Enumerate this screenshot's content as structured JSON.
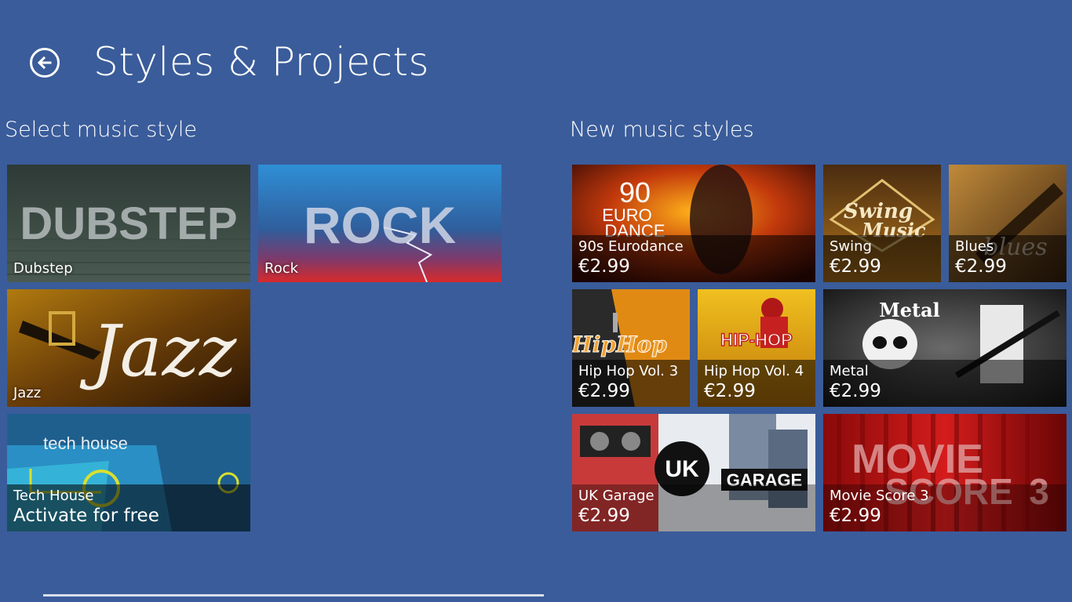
{
  "header": {
    "title": "Styles & Projects",
    "back_icon": "arrow-left-icon"
  },
  "colors": {
    "background": "#3a5c9a"
  },
  "left_section": {
    "title": "Select music style",
    "tiles": [
      {
        "id": "dubstep",
        "label": "Dubstep",
        "art_text": "DUBSTEP"
      },
      {
        "id": "rock",
        "label": "Rock",
        "art_text": "ROCK"
      },
      {
        "id": "jazz",
        "label": "Jazz",
        "art_text": "Jazz"
      },
      {
        "id": "techhouse",
        "label": "Tech House",
        "sub": "Activate for free",
        "art_text": "tech house"
      }
    ]
  },
  "right_section": {
    "title": "New music styles",
    "tiles": [
      {
        "id": "eurodance",
        "label": "90s Eurodance",
        "price": "€2.99",
        "art_text_1": "90",
        "art_text_2": "EURO",
        "art_text_3": "DANCE"
      },
      {
        "id": "swing",
        "label": "Swing",
        "price": "€2.99",
        "art_text_1": "Swing",
        "art_text_2": "Music"
      },
      {
        "id": "blues",
        "label": "Blues",
        "price": "€2.99",
        "art_text": "blues"
      },
      {
        "id": "hiphop3",
        "label": "Hip Hop Vol. 3",
        "price": "€2.99",
        "art_text": "HipHop"
      },
      {
        "id": "hiphop4",
        "label": "Hip Hop Vol. 4",
        "price": "€2.99",
        "art_text": "HIP-HOP"
      },
      {
        "id": "metal",
        "label": "Metal",
        "price": "€2.99",
        "art_text": "Metal"
      },
      {
        "id": "ukgarage",
        "label": "UK Garage",
        "price": "€2.99",
        "art_text_1": "UK",
        "art_text_2": "GARAGE"
      },
      {
        "id": "moviescore",
        "label": "Movie Score 3",
        "price": "€2.99",
        "art_text_1": "MOVIE",
        "art_text_2": "SCORE",
        "art_text_3": "3"
      }
    ]
  }
}
